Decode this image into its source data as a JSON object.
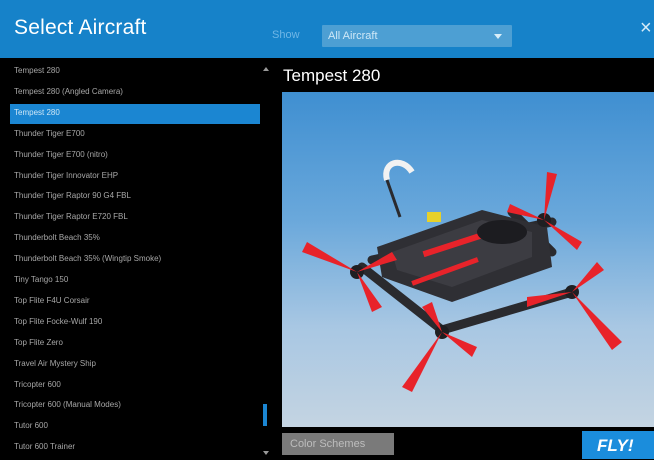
{
  "window": {
    "title": "Select Aircraft",
    "close_glyph": "×",
    "close_icon": "close-icon"
  },
  "filter": {
    "label": "Show",
    "selected": "All Aircraft"
  },
  "aircraft_list": {
    "items": [
      "Tempest 280",
      "Tempest 280 (Angled Camera)",
      "Tempest 280",
      "Thunder Tiger E700",
      "Thunder Tiger E700 (nitro)",
      "Thunder Tiger Innovator EHP",
      "Thunder Tiger Raptor 90 G4 FBL",
      "Thunder Tiger Raptor E720 FBL",
      "Thunderbolt Beach 35%",
      "Thunderbolt Beach 35% (Wingtip Smoke)",
      "Tiny Tango 150",
      "Top Flite F4U Corsair",
      "Top Flite Focke-Wulf 190",
      "Top Flite Zero",
      "Travel Air Mystery Ship",
      "Tricopter 600",
      "Tricopter 600 (Manual Modes)",
      "Tutor 600",
      "Tutor 600 Trainer"
    ],
    "selected_index": 2
  },
  "preview": {
    "title": "Tempest 280"
  },
  "buttons": {
    "color_schemes": "Color Schemes",
    "fly": "FLY!"
  },
  "colors": {
    "accent": "#1682c9",
    "background": "#000000",
    "prop_red": "#e8232a"
  }
}
